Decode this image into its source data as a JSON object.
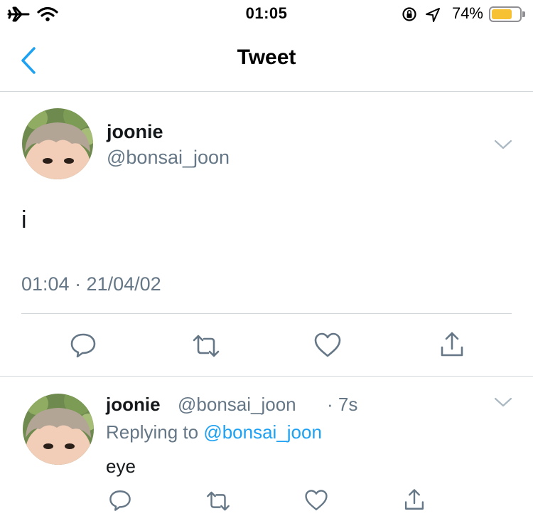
{
  "status_bar": {
    "time": "01:05",
    "battery_percent": "74%",
    "battery_level": 0.74,
    "icons": [
      "airplane-icon",
      "wifi-icon",
      "orientation-lock-icon",
      "location-icon",
      "battery-icon"
    ]
  },
  "nav": {
    "title": "Tweet",
    "back_icon": "chevron-left-icon"
  },
  "tweet": {
    "display_name": "joonie",
    "handle": "@bonsai_joon",
    "text": "i",
    "timestamp": "01:04 · 21/04/02",
    "actions": [
      "reply-icon",
      "retweet-icon",
      "like-icon",
      "share-icon"
    ]
  },
  "reply": {
    "display_name": "joonie",
    "handle": "@bonsai_joon",
    "time": "· 7s",
    "replying_prefix": "Replying to ",
    "replying_to": "@bonsai_joon",
    "text": "eye",
    "actions": [
      "reply-icon",
      "retweet-icon",
      "like-icon",
      "share-icon"
    ]
  },
  "colors": {
    "accent": "#1da1f2",
    "text_primary": "#14171a",
    "text_secondary": "#657786",
    "divider": "#d3d6db",
    "battery_fill": "#f6c234"
  }
}
